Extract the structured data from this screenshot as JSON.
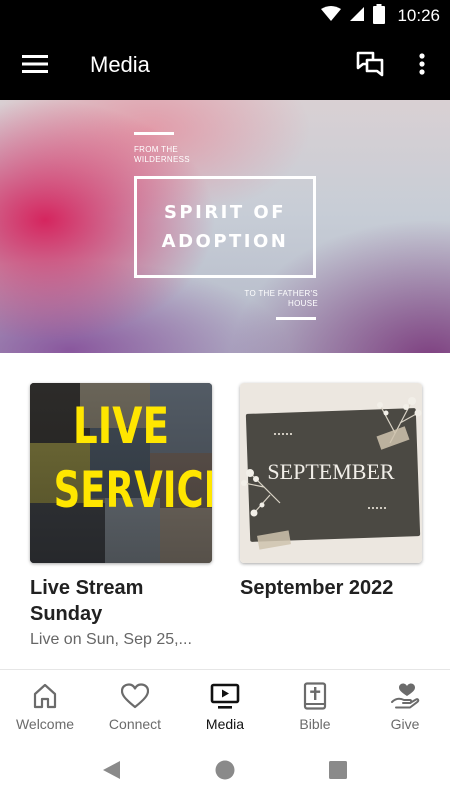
{
  "status_bar": {
    "time": "10:26",
    "icons": [
      "wifi-icon",
      "signal-icon",
      "battery-icon"
    ]
  },
  "app_bar": {
    "title": "Media",
    "icons": [
      "menu-icon",
      "chat-icon",
      "more-vert-icon"
    ]
  },
  "banner": {
    "top_text": "FROM THE WILDERNESS",
    "title_line1": "SPIRIT OF",
    "title_line2": "ADOPTION",
    "bottom_text": "TO THE FATHER'S HOUSE"
  },
  "cards": [
    {
      "image_text_line1": "LIVE",
      "image_text_line2": "SERVICE",
      "title": "Live Stream Sunday",
      "subtitle": "Live on Sun, Sep 25,..."
    },
    {
      "image_text": "SEPTEMBER",
      "title": "September 2022"
    }
  ],
  "bottom_nav": {
    "items": [
      {
        "label": "Welcome",
        "icon": "home-icon",
        "active": false
      },
      {
        "label": "Connect",
        "icon": "heart-icon",
        "active": false
      },
      {
        "label": "Media",
        "icon": "media-tv-icon",
        "active": true
      },
      {
        "label": "Bible",
        "icon": "bible-icon",
        "active": false
      },
      {
        "label": "Give",
        "icon": "give-hand-heart-icon",
        "active": false
      }
    ]
  },
  "colors": {
    "app_bar": "#000000",
    "live_text": "#ffe600",
    "nav_active": "#111111",
    "nav_inactive": "#6b6b6b"
  }
}
